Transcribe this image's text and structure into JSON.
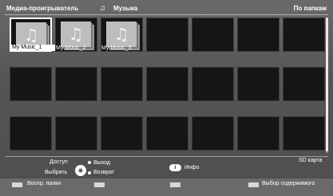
{
  "header": {
    "title": "Медиа-проигрыватель",
    "section": "Музыка",
    "mode": "По папкам",
    "note_icon": "music-note-icon"
  },
  "folders": [
    {
      "label": "My Music_1",
      "icon": "music-note-icon",
      "selected": true
    },
    {
      "label": "My Music_2",
      "icon": "music-note-icon",
      "selected": false
    },
    {
      "label": "My Music_3",
      "icon": "music-note-icon",
      "selected": false
    }
  ],
  "footer": {
    "access": "Доступ",
    "select": "Выбрать",
    "exit": "Выход",
    "back": "Возврат",
    "info_icon": "i",
    "info": "Инфо",
    "storage": "SD карта",
    "play_folder": "Воспр. папки",
    "select_content": "Выбор содержимого"
  },
  "colors": {
    "background": "#5b5b5b",
    "tile": "#151515",
    "key": "#d8d8d8",
    "selected_border": "#ffffff"
  }
}
